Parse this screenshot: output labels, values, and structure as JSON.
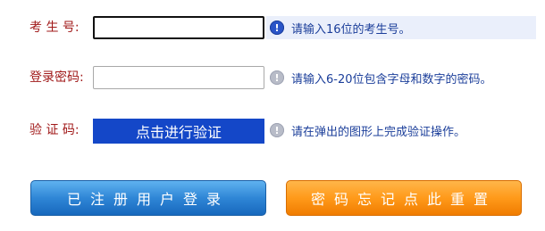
{
  "form": {
    "candidate_number": {
      "label": "考 生 号:",
      "value": "",
      "placeholder": "",
      "hint": "请输入16位的考生号。",
      "hint_icon": "info-icon",
      "hint_icon_glyph": "!"
    },
    "password": {
      "label": "登录密码:",
      "value": "",
      "placeholder": "",
      "hint": "请输入6-20位包含字母和数字的密码。",
      "hint_icon": "info-icon",
      "hint_icon_glyph": "!"
    },
    "captcha": {
      "label": "验 证 码:",
      "button_label": "点击进行验证",
      "hint": "请在弹出的图形上完成验证操作。",
      "hint_icon": "info-icon",
      "hint_icon_glyph": "!"
    }
  },
  "actions": {
    "login_label": "已注册用户登录",
    "reset_password_label": "密码忘记点此重置"
  },
  "colors": {
    "label": "#a11a1a",
    "hint_text": "#1b3e9a",
    "hint_highlight_bg": "#eaeffb",
    "verify_button_bg": "#1447c8",
    "login_button": "#2f86d6",
    "reset_button": "#ff9a1a"
  }
}
